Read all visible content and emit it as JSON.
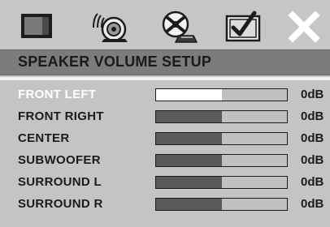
{
  "tabs": [
    {
      "icon": "video-setup-icon"
    },
    {
      "icon": "audio-setup-icon"
    },
    {
      "icon": "disc-setup-icon"
    },
    {
      "icon": "preference-setup-icon"
    },
    {
      "icon": "exit-icon"
    }
  ],
  "title": "SPEAKER VOLUME SETUP",
  "colors": {
    "background": "#c4c4c4",
    "title_bar": "#7c7c7c",
    "bar_fill": "#5a5a5a",
    "selected_fill": "#ffffff"
  },
  "rows": [
    {
      "label": "FRONT LEFT",
      "value": "0dB",
      "level": 0.5,
      "selected": true
    },
    {
      "label": "FRONT RIGHT",
      "value": "0dB",
      "level": 0.5,
      "selected": false
    },
    {
      "label": "CENTER",
      "value": "0dB",
      "level": 0.5,
      "selected": false
    },
    {
      "label": "SUBWOOFER",
      "value": "0dB",
      "level": 0.5,
      "selected": false
    },
    {
      "label": "SURROUND L",
      "value": "0dB",
      "level": 0.5,
      "selected": false
    },
    {
      "label": "SURROUND R",
      "value": "0dB",
      "level": 0.5,
      "selected": false
    }
  ]
}
